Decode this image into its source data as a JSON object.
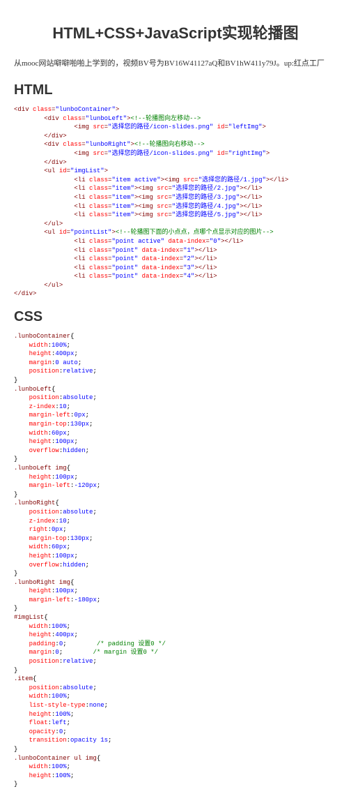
{
  "title": "HTML+CSS+JavaScript实现轮播图",
  "intro": "从mooc网站噼噼啪啪上学到的，视频BV号为BV16W41127aQ和BV1hW411y79J。up:红点工厂",
  "html_heading": "HTML",
  "css_heading": "CSS",
  "html_code": [
    {
      "i": 0,
      "t": "tag",
      "pre": "<",
      "name": "div",
      "attrs": [
        {
          "n": "class",
          "v": "lunboContainer"
        }
      ],
      "post": ">"
    },
    {
      "i": 1,
      "t": "tag",
      "pre": "<",
      "name": "div",
      "attrs": [
        {
          "n": "class",
          "v": "lunboLeft"
        }
      ],
      "post": ">",
      "comment": "<!--轮播图向左移动-->"
    },
    {
      "i": 2,
      "t": "tag",
      "pre": "<",
      "name": "img",
      "attrs": [
        {
          "n": "src",
          "v": "选择您的路径/icon-slides.png"
        },
        {
          "n": "id",
          "v": "leftImg"
        }
      ],
      "post": ">"
    },
    {
      "i": 1,
      "t": "tag",
      "pre": "</",
      "name": "div",
      "post": ">"
    },
    {
      "i": 1,
      "t": "tag",
      "pre": "<",
      "name": "div",
      "attrs": [
        {
          "n": "class",
          "v": "lunboRight"
        }
      ],
      "post": ">",
      "comment": "<!--轮播图向右移动-->"
    },
    {
      "i": 2,
      "t": "tag",
      "pre": "<",
      "name": "img",
      "attrs": [
        {
          "n": "src",
          "v": "选择您的路径/icon-slides.png"
        },
        {
          "n": "id",
          "v": "rightImg"
        }
      ],
      "post": ">"
    },
    {
      "i": 1,
      "t": "tag",
      "pre": "</",
      "name": "div",
      "post": ">"
    },
    {
      "i": 1,
      "t": "tag",
      "pre": "<",
      "name": "ul",
      "attrs": [
        {
          "n": "id",
          "v": "imgList"
        }
      ],
      "post": ">"
    },
    {
      "i": 2,
      "t": "liimg",
      "cls": "item active",
      "src": "选择您的路径/1.jpg"
    },
    {
      "i": 2,
      "t": "liimg",
      "cls": "item",
      "src": "选择您的路径/2.jpg"
    },
    {
      "i": 2,
      "t": "liimg",
      "cls": "item",
      "src": "选择您的路径/3.jpg"
    },
    {
      "i": 2,
      "t": "liimg",
      "cls": "item",
      "src": "选择您的路径/4.jpg"
    },
    {
      "i": 2,
      "t": "liimg",
      "cls": "item",
      "src": "选择您的路径/5.jpg"
    },
    {
      "i": 1,
      "t": "tag",
      "pre": "</",
      "name": "ul",
      "post": ">"
    },
    {
      "i": 1,
      "t": "tag",
      "pre": "<",
      "name": "ul",
      "attrs": [
        {
          "n": "id",
          "v": "pointList"
        }
      ],
      "post": ">",
      "comment": "<!--轮播图下面的小点点，点哪个点显示对应的图片-->"
    },
    {
      "i": 2,
      "t": "lipoint",
      "cls": "point active",
      "idx": "0"
    },
    {
      "i": 2,
      "t": "lipoint",
      "cls": "point",
      "idx": "1"
    },
    {
      "i": 2,
      "t": "lipoint",
      "cls": "point",
      "idx": "2"
    },
    {
      "i": 2,
      "t": "lipoint",
      "cls": "point",
      "idx": "3"
    },
    {
      "i": 2,
      "t": "lipoint",
      "cls": "point",
      "idx": "4"
    },
    {
      "i": 1,
      "t": "tag",
      "pre": "</",
      "name": "ul",
      "post": ">"
    },
    {
      "i": 0,
      "t": "tag",
      "pre": "</",
      "name": "div",
      "post": ">"
    }
  ],
  "css_code": [
    {
      "sel": ".lunboContainer",
      "rules": [
        [
          "width",
          "100%"
        ],
        [
          "height",
          "400px"
        ],
        [
          "margin",
          "0 auto"
        ],
        [
          "position",
          "relative"
        ]
      ]
    },
    {
      "sel": ".lunboLeft",
      "rules": [
        [
          "position",
          "absolute"
        ],
        [
          "z-index",
          "10"
        ],
        [
          "margin-left",
          "0px"
        ],
        [
          "margin-top",
          "130px"
        ],
        [
          "width",
          "60px"
        ],
        [
          "height",
          "100px"
        ],
        [
          "overflow",
          "hidden"
        ]
      ]
    },
    {
      "sel": ".lunboLeft img",
      "rules": [
        [
          "height",
          "100px"
        ],
        [
          "margin-left",
          "-120px"
        ]
      ]
    },
    {
      "sel": ".lunboRight",
      "rules": [
        [
          "position",
          "absolute"
        ],
        [
          "z-index",
          "10"
        ],
        [
          "right",
          "0px"
        ],
        [
          "margin-top",
          "130px"
        ],
        [
          "width",
          "60px"
        ],
        [
          "height",
          "100px"
        ],
        [
          "overflow",
          "hidden"
        ]
      ]
    },
    {
      "sel": ".lunboRight img",
      "rules": [
        [
          "height",
          "100px"
        ],
        [
          "margin-left",
          "-180px"
        ]
      ]
    },
    {
      "sel": "#imgList",
      "rules": [
        [
          "width",
          "100%"
        ],
        [
          "height",
          "400px"
        ],
        [
          "padding",
          "0",
          "/* padding 设置0 */"
        ],
        [
          "margin",
          "0",
          "/* margin 设置0 */"
        ],
        [
          "position",
          "relative"
        ]
      ]
    },
    {
      "sel": ".item",
      "rules": [
        [
          "position",
          "absolute"
        ],
        [
          "width",
          "100%"
        ],
        [
          "list-style-type",
          "none"
        ],
        [
          "height",
          "100%"
        ],
        [
          "float",
          "left"
        ],
        [
          "opacity",
          "0"
        ],
        [
          "transition",
          "opacity 1s"
        ]
      ]
    },
    {
      "sel": ".lunboContainer ul img",
      "rules": [
        [
          "width",
          "100%"
        ],
        [
          "height",
          "100%"
        ]
      ]
    }
  ]
}
